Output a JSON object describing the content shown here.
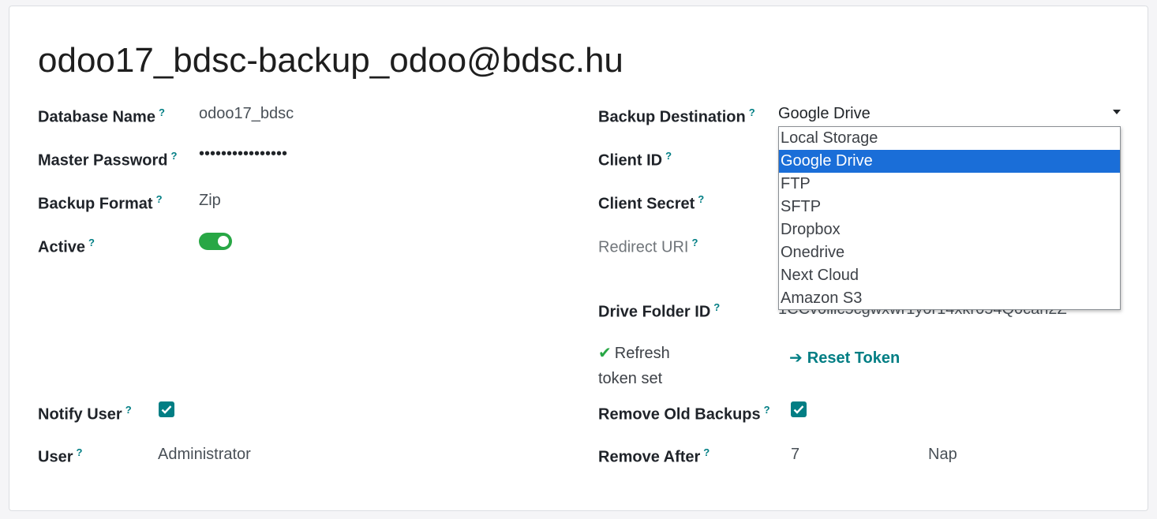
{
  "record": {
    "title": "odoo17_bdsc-backup_odoo@bdsc.hu"
  },
  "help_mark": "?",
  "left": {
    "database_name": {
      "label": "Database Name",
      "value": "odoo17_bdsc"
    },
    "master_password": {
      "label": "Master Password",
      "value": "••••••••••••••••"
    },
    "backup_format": {
      "label": "Backup Format",
      "value": "Zip"
    },
    "active": {
      "label": "Active",
      "value": true
    },
    "notify_user": {
      "label": "Notify User",
      "checked": true
    },
    "user": {
      "label": "User",
      "value": "Administrator"
    }
  },
  "right": {
    "backup_destination": {
      "label": "Backup Destination",
      "value": "Google Drive",
      "options": [
        "Local Storage",
        "Google Drive",
        "FTP",
        "SFTP",
        "Dropbox",
        "Onedrive",
        "Next Cloud",
        "Amazon S3"
      ],
      "selected_index": 1
    },
    "client_id": {
      "label": "Client ID"
    },
    "client_secret": {
      "label": "Client Secret"
    },
    "redirect_uri": {
      "label": "Redirect URI"
    },
    "drive_folder_id": {
      "label": "Drive Folder ID",
      "value_partial": "1CCv0ilic5cgwxwr1y0r14xkr054Q0can2Z"
    },
    "refresh_status": {
      "text": "Refresh token set"
    },
    "reset_token": {
      "label": "Reset Token"
    },
    "remove_old_backups": {
      "label": "Remove Old Backups",
      "checked": true
    },
    "remove_after": {
      "label": "Remove After",
      "value": "7",
      "unit": "Nap"
    }
  },
  "colors": {
    "accent": "#017e84",
    "toggle_on": "#28a745",
    "dropdown_selected": "#1a6ed8"
  },
  "icons": {
    "check": "check-icon",
    "arrow_right": "arrow-right-icon",
    "caret": "caret-down-icon"
  }
}
